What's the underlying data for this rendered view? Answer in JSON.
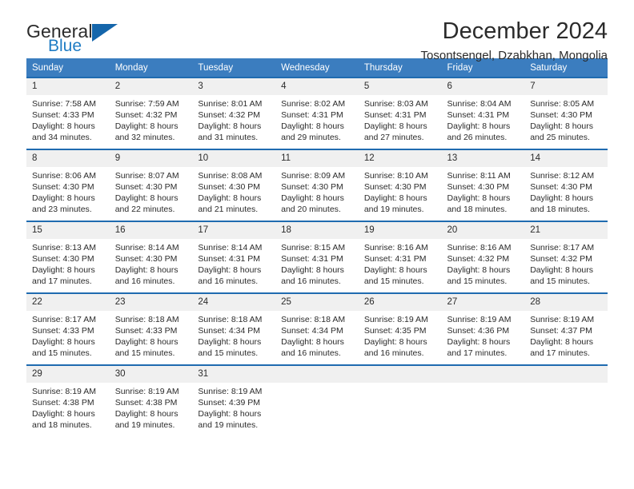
{
  "brand": {
    "line1": "General",
    "line2": "Blue",
    "triangle_color": "#1566ab",
    "blue_color": "#1f7cc4"
  },
  "header": {
    "title": "December 2024",
    "subtitle": "Tosontsengel, Dzabkhan, Mongolia",
    "header_bg": "#3b7dbf",
    "row_border": "#1f6bb0",
    "daynum_bg": "#f0f0f0"
  },
  "weekdays": [
    "Sunday",
    "Monday",
    "Tuesday",
    "Wednesday",
    "Thursday",
    "Friday",
    "Saturday"
  ],
  "weeks": [
    [
      {
        "day": "1",
        "sunrise": "Sunrise: 7:58 AM",
        "sunset": "Sunset: 4:33 PM",
        "daylight1": "Daylight: 8 hours",
        "daylight2": "and 34 minutes."
      },
      {
        "day": "2",
        "sunrise": "Sunrise: 7:59 AM",
        "sunset": "Sunset: 4:32 PM",
        "daylight1": "Daylight: 8 hours",
        "daylight2": "and 32 minutes."
      },
      {
        "day": "3",
        "sunrise": "Sunrise: 8:01 AM",
        "sunset": "Sunset: 4:32 PM",
        "daylight1": "Daylight: 8 hours",
        "daylight2": "and 31 minutes."
      },
      {
        "day": "4",
        "sunrise": "Sunrise: 8:02 AM",
        "sunset": "Sunset: 4:31 PM",
        "daylight1": "Daylight: 8 hours",
        "daylight2": "and 29 minutes."
      },
      {
        "day": "5",
        "sunrise": "Sunrise: 8:03 AM",
        "sunset": "Sunset: 4:31 PM",
        "daylight1": "Daylight: 8 hours",
        "daylight2": "and 27 minutes."
      },
      {
        "day": "6",
        "sunrise": "Sunrise: 8:04 AM",
        "sunset": "Sunset: 4:31 PM",
        "daylight1": "Daylight: 8 hours",
        "daylight2": "and 26 minutes."
      },
      {
        "day": "7",
        "sunrise": "Sunrise: 8:05 AM",
        "sunset": "Sunset: 4:30 PM",
        "daylight1": "Daylight: 8 hours",
        "daylight2": "and 25 minutes."
      }
    ],
    [
      {
        "day": "8",
        "sunrise": "Sunrise: 8:06 AM",
        "sunset": "Sunset: 4:30 PM",
        "daylight1": "Daylight: 8 hours",
        "daylight2": "and 23 minutes."
      },
      {
        "day": "9",
        "sunrise": "Sunrise: 8:07 AM",
        "sunset": "Sunset: 4:30 PM",
        "daylight1": "Daylight: 8 hours",
        "daylight2": "and 22 minutes."
      },
      {
        "day": "10",
        "sunrise": "Sunrise: 8:08 AM",
        "sunset": "Sunset: 4:30 PM",
        "daylight1": "Daylight: 8 hours",
        "daylight2": "and 21 minutes."
      },
      {
        "day": "11",
        "sunrise": "Sunrise: 8:09 AM",
        "sunset": "Sunset: 4:30 PM",
        "daylight1": "Daylight: 8 hours",
        "daylight2": "and 20 minutes."
      },
      {
        "day": "12",
        "sunrise": "Sunrise: 8:10 AM",
        "sunset": "Sunset: 4:30 PM",
        "daylight1": "Daylight: 8 hours",
        "daylight2": "and 19 minutes."
      },
      {
        "day": "13",
        "sunrise": "Sunrise: 8:11 AM",
        "sunset": "Sunset: 4:30 PM",
        "daylight1": "Daylight: 8 hours",
        "daylight2": "and 18 minutes."
      },
      {
        "day": "14",
        "sunrise": "Sunrise: 8:12 AM",
        "sunset": "Sunset: 4:30 PM",
        "daylight1": "Daylight: 8 hours",
        "daylight2": "and 18 minutes."
      }
    ],
    [
      {
        "day": "15",
        "sunrise": "Sunrise: 8:13 AM",
        "sunset": "Sunset: 4:30 PM",
        "daylight1": "Daylight: 8 hours",
        "daylight2": "and 17 minutes."
      },
      {
        "day": "16",
        "sunrise": "Sunrise: 8:14 AM",
        "sunset": "Sunset: 4:30 PM",
        "daylight1": "Daylight: 8 hours",
        "daylight2": "and 16 minutes."
      },
      {
        "day": "17",
        "sunrise": "Sunrise: 8:14 AM",
        "sunset": "Sunset: 4:31 PM",
        "daylight1": "Daylight: 8 hours",
        "daylight2": "and 16 minutes."
      },
      {
        "day": "18",
        "sunrise": "Sunrise: 8:15 AM",
        "sunset": "Sunset: 4:31 PM",
        "daylight1": "Daylight: 8 hours",
        "daylight2": "and 16 minutes."
      },
      {
        "day": "19",
        "sunrise": "Sunrise: 8:16 AM",
        "sunset": "Sunset: 4:31 PM",
        "daylight1": "Daylight: 8 hours",
        "daylight2": "and 15 minutes."
      },
      {
        "day": "20",
        "sunrise": "Sunrise: 8:16 AM",
        "sunset": "Sunset: 4:32 PM",
        "daylight1": "Daylight: 8 hours",
        "daylight2": "and 15 minutes."
      },
      {
        "day": "21",
        "sunrise": "Sunrise: 8:17 AM",
        "sunset": "Sunset: 4:32 PM",
        "daylight1": "Daylight: 8 hours",
        "daylight2": "and 15 minutes."
      }
    ],
    [
      {
        "day": "22",
        "sunrise": "Sunrise: 8:17 AM",
        "sunset": "Sunset: 4:33 PM",
        "daylight1": "Daylight: 8 hours",
        "daylight2": "and 15 minutes."
      },
      {
        "day": "23",
        "sunrise": "Sunrise: 8:18 AM",
        "sunset": "Sunset: 4:33 PM",
        "daylight1": "Daylight: 8 hours",
        "daylight2": "and 15 minutes."
      },
      {
        "day": "24",
        "sunrise": "Sunrise: 8:18 AM",
        "sunset": "Sunset: 4:34 PM",
        "daylight1": "Daylight: 8 hours",
        "daylight2": "and 15 minutes."
      },
      {
        "day": "25",
        "sunrise": "Sunrise: 8:18 AM",
        "sunset": "Sunset: 4:34 PM",
        "daylight1": "Daylight: 8 hours",
        "daylight2": "and 16 minutes."
      },
      {
        "day": "26",
        "sunrise": "Sunrise: 8:19 AM",
        "sunset": "Sunset: 4:35 PM",
        "daylight1": "Daylight: 8 hours",
        "daylight2": "and 16 minutes."
      },
      {
        "day": "27",
        "sunrise": "Sunrise: 8:19 AM",
        "sunset": "Sunset: 4:36 PM",
        "daylight1": "Daylight: 8 hours",
        "daylight2": "and 17 minutes."
      },
      {
        "day": "28",
        "sunrise": "Sunrise: 8:19 AM",
        "sunset": "Sunset: 4:37 PM",
        "daylight1": "Daylight: 8 hours",
        "daylight2": "and 17 minutes."
      }
    ],
    [
      {
        "day": "29",
        "sunrise": "Sunrise: 8:19 AM",
        "sunset": "Sunset: 4:38 PM",
        "daylight1": "Daylight: 8 hours",
        "daylight2": "and 18 minutes."
      },
      {
        "day": "30",
        "sunrise": "Sunrise: 8:19 AM",
        "sunset": "Sunset: 4:38 PM",
        "daylight1": "Daylight: 8 hours",
        "daylight2": "and 19 minutes."
      },
      {
        "day": "31",
        "sunrise": "Sunrise: 8:19 AM",
        "sunset": "Sunset: 4:39 PM",
        "daylight1": "Daylight: 8 hours",
        "daylight2": "and 19 minutes."
      },
      {
        "day": "",
        "sunrise": "",
        "sunset": "",
        "daylight1": "",
        "daylight2": ""
      },
      {
        "day": "",
        "sunrise": "",
        "sunset": "",
        "daylight1": "",
        "daylight2": ""
      },
      {
        "day": "",
        "sunrise": "",
        "sunset": "",
        "daylight1": "",
        "daylight2": ""
      },
      {
        "day": "",
        "sunrise": "",
        "sunset": "",
        "daylight1": "",
        "daylight2": ""
      }
    ]
  ]
}
